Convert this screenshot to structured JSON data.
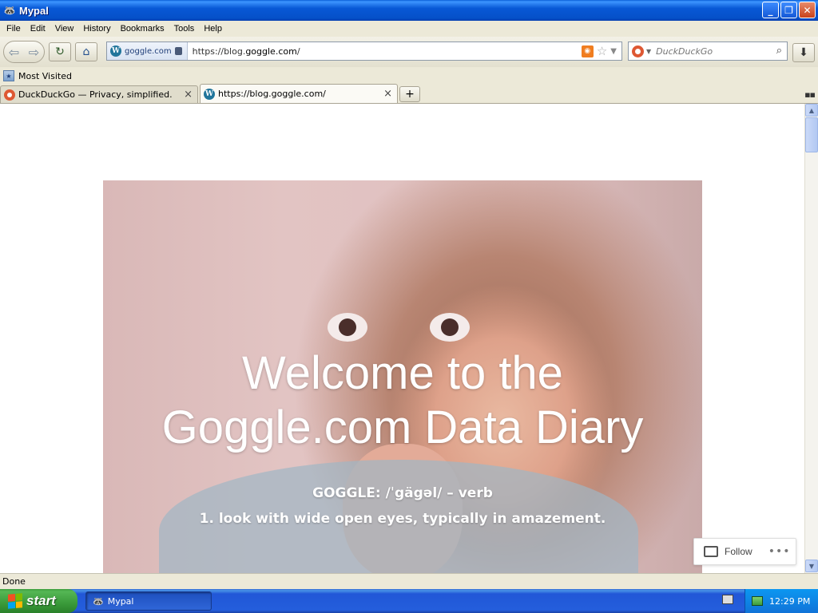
{
  "window": {
    "title": "Mypal"
  },
  "menu": [
    "File",
    "Edit",
    "View",
    "History",
    "Bookmarks",
    "Tools",
    "Help"
  ],
  "urlbar": {
    "identity": "goggle.com",
    "url_prefix": "https://blog.",
    "url_host": "goggle.com",
    "url_suffix": "/"
  },
  "search": {
    "placeholder": "DuckDuckGo"
  },
  "bookmarks": {
    "most_visited": "Most Visited"
  },
  "tabs": [
    {
      "title": "DuckDuckGo — Privacy, simplified.",
      "active": false
    },
    {
      "title": "https://blog.goggle.com/",
      "active": true
    }
  ],
  "hero": {
    "title_line1": "Welcome to the",
    "title_line2": "Goggle.com Data Diary",
    "sub_line1": "GOGGLE: /ˈgägəl/ – verb",
    "sub_line2": "1. look with wide open eyes, typically in amazement."
  },
  "follow": {
    "label": "Follow"
  },
  "status": {
    "text": "Done"
  },
  "taskbar": {
    "start": "start",
    "task_title": "Mypal",
    "clock": "12:29 PM"
  }
}
